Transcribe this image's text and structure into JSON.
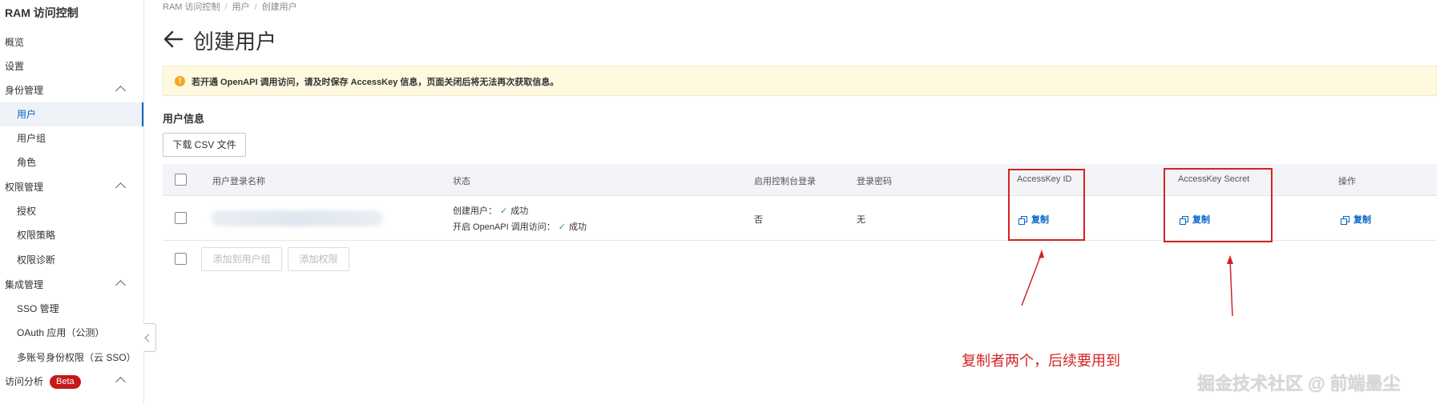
{
  "sidebar": {
    "title": "RAM 访问控制",
    "items": [
      {
        "label": "概览"
      },
      {
        "label": "设置"
      },
      {
        "label": "身份管理"
      },
      {
        "label": "用户"
      },
      {
        "label": "用户组"
      },
      {
        "label": "角色"
      },
      {
        "label": "权限管理"
      },
      {
        "label": "授权"
      },
      {
        "label": "权限策略"
      },
      {
        "label": "权限诊断"
      },
      {
        "label": "集成管理"
      },
      {
        "label": "SSO 管理"
      },
      {
        "label": "OAuth 应用（公测）"
      },
      {
        "label": "多账号身份权限（云 SSO）"
      },
      {
        "label": "访问分析"
      }
    ],
    "beta_badge": "Beta"
  },
  "breadcrumb": [
    "RAM 访问控制",
    "用户",
    "创建用户"
  ],
  "page_title": "创建用户",
  "alert": {
    "icon": "warning-icon",
    "text": "若开通 OpenAPI 调用访问，请及时保存 AccessKey 信息，页面关闭后将无法再次获取信息。"
  },
  "section_title": "用户信息",
  "download_button": "下载 CSV 文件",
  "table": {
    "columns": [
      "用户登录名称",
      "状态",
      "启用控制台登录",
      "登录密码",
      "AccessKey ID",
      "AccessKey Secret",
      "操作"
    ],
    "row": {
      "status_line1_label": "创建用户：",
      "status_line1_value": "成功",
      "status_line2_label": "开启 OpenAPI 调用访问：",
      "status_line2_value": "成功",
      "console_login": "否",
      "password": "无",
      "accesskey_id_action": "复制",
      "accesskey_secret_action": "复制",
      "operation_action": "复制"
    }
  },
  "footer_buttons": {
    "add_to_group": "添加到用户组",
    "add_permission": "添加权限"
  },
  "annotation": "复制者两个，后续要用到",
  "watermark": "掘金技术社区 @ 前端墨尘",
  "colors": {
    "accent": "#0064c8",
    "annotation_red": "#d42222",
    "alert_bg": "#fff9e0",
    "success_green": "#33a33a",
    "beta_red": "#c6191a"
  }
}
